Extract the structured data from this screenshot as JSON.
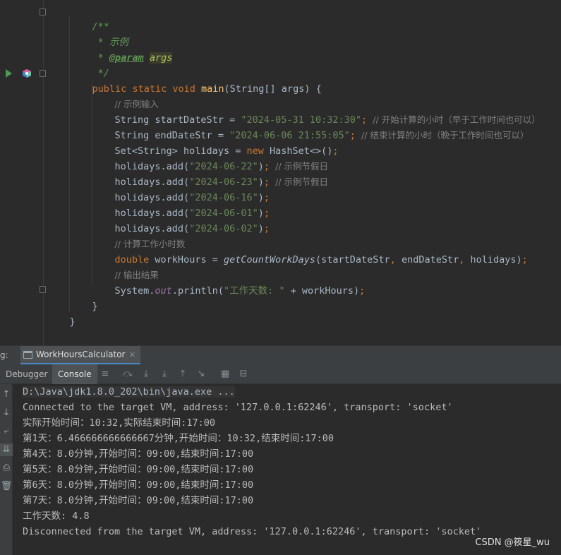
{
  "editor": {
    "doc_open": "/**",
    "doc_desc": " * 示例",
    "doc_param_prefix": " * ",
    "doc_param_tag": "@param",
    "doc_param_name": "args",
    "doc_close": " */",
    "main_kw_public": "public",
    "main_kw_static": "static",
    "main_kw_void": "void",
    "main_name": "main",
    "main_params": "(String[] args) {",
    "comment_input": "// 示例输入",
    "start_decl": "String startDateStr = ",
    "start_value": "\"2024-05-31 10:32:30\"",
    "start_semicolon": ";",
    "start_comment": "// 开始计算的小时（早于工作时间也可以）",
    "end_decl": "String endDateStr = ",
    "end_value": "\"2024-06-06 21:55:05\"",
    "end_semicolon": ";",
    "end_comment": "// 结束计算的小时（晚于工作时间也可以）",
    "set_decl": "Set<String> holidays = ",
    "set_new": "new",
    "set_init": " HashSet<>()",
    "set_semicolon": ";",
    "holidays": [
      {
        "call": "holidays.add(",
        "value": "\"2024-06-22\"",
        "close": ")",
        "semi": ";",
        "comment": "// 示例节假日"
      },
      {
        "call": "holidays.add(",
        "value": "\"2024-06-23\"",
        "close": ")",
        "semi": ";",
        "comment": "// 示例节假日"
      },
      {
        "call": "holidays.add(",
        "value": "\"2024-06-16\"",
        "close": ")",
        "semi": ";",
        "comment": ""
      },
      {
        "call": "holidays.add(",
        "value": "\"2024-06-01\"",
        "close": ")",
        "semi": ";",
        "comment": ""
      },
      {
        "call": "holidays.add(",
        "value": "\"2024-06-02\"",
        "close": ")",
        "semi": ";",
        "comment": ""
      }
    ],
    "comment_calc": "// 计算工作小时数",
    "calc_type": "double",
    "calc_assign": " workHours = ",
    "calc_method": "getCountWorkDays",
    "calc_args_1": "(startDateStr",
    "calc_comma_1": ",",
    "calc_args_2": " endDateStr",
    "calc_comma_2": ",",
    "calc_args_3": " holidays)",
    "calc_semi": ";",
    "comment_output": "// 输出结果",
    "print_system": "System.",
    "print_out": "out",
    "print_println": ".println(",
    "print_string": "\"工作天数: \"",
    "print_rest": " + workHours)",
    "print_semi": ";",
    "close_method": "}",
    "close_class": "}"
  },
  "run_window": {
    "prefix": "g:",
    "tab_label": "WorkHoursCalculator",
    "tab_close": "×",
    "tabs": [
      "Debugger",
      "Console"
    ],
    "active_tab": "Console"
  },
  "console": {
    "lines": [
      "D:\\Java\\jdk1.8.0_202\\bin\\java.exe ...",
      "Connected to the target VM, address: '127.0.0.1:62246', transport: 'socket'",
      "实际开始时间：10:32,实际结束时间:17:00",
      "第1天：6.466666666666667分钟,开始时间：10:32,结束时间:17:00",
      "第4天：8.0分钟,开始时间：09:00,结束时间:17:00",
      "第5天：8.0分钟,开始时间：09:00,结束时间:17:00",
      "第6天：8.0分钟,开始时间：09:00,结束时间:17:00",
      "第7天：8.0分钟,开始时间：09:00,结束时间:17:00",
      "工作天数: 4.8",
      "Disconnected from the target VM, address: '127.0.0.1:62246', transport: 'socket'"
    ]
  },
  "watermark": "CSDN @筱星_wu",
  "colors": {
    "editor_bg": "#2b2b2b",
    "keyword": "#cc7832",
    "string": "#6a8759",
    "method": "#ffc66d",
    "comment": "#808080",
    "javadoc": "#629755",
    "field": "#9876aa",
    "run_green": "#499c54",
    "tab_underline": "#4a88c7"
  },
  "icons": {
    "run_gutter": "run-triangle-icon",
    "bean_gutter": "spring-bean-icon",
    "toolbar": [
      "menu-icon",
      "step-over-icon",
      "step-into-icon",
      "force-step-into-icon",
      "step-out-icon",
      "run-to-cursor-icon",
      "evaluate-icon",
      "trace-icon"
    ],
    "side": [
      "up-arrow-icon",
      "down-arrow-icon",
      "soft-wrap-icon",
      "scroll-to-end-icon",
      "print-icon",
      "trash-icon"
    ]
  }
}
